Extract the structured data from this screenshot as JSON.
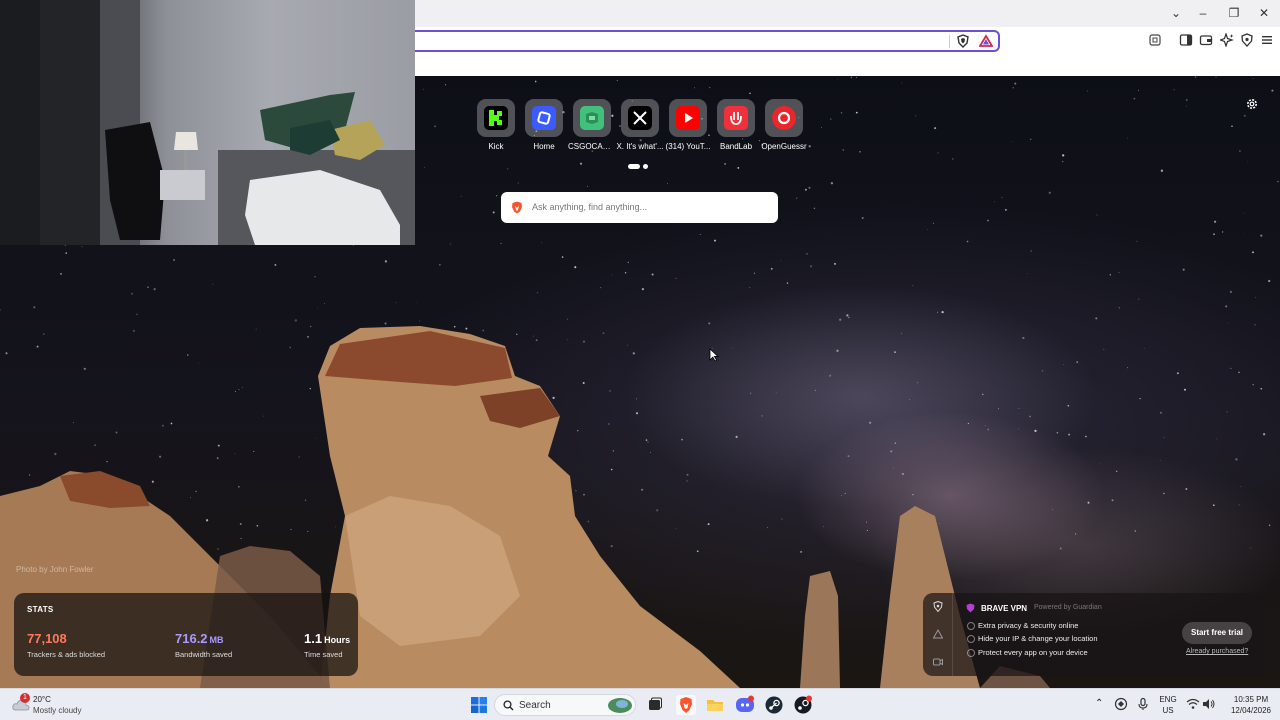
{
  "browser": {
    "search_placeholder": "Ask anything, find anything..."
  },
  "top_sites": [
    {
      "label": "Kick",
      "icon": "kick-icon",
      "color": "#53fc18"
    },
    {
      "label": "Home",
      "icon": "home-icon",
      "color": "#3b5bff"
    },
    {
      "label": "CSGOCASE...",
      "icon": "csgocase-icon",
      "color": "#41c27a"
    },
    {
      "label": "X. It's what'...",
      "icon": "x-icon",
      "color": "#000000"
    },
    {
      "label": "(314) YouT...",
      "icon": "youtube-icon",
      "color": "#ff0000"
    },
    {
      "label": "BandLab",
      "icon": "bandlab-icon",
      "color": "#f0303a"
    },
    {
      "label": "OpenGuessr",
      "icon": "openguessr-icon",
      "color": "#e8262b"
    }
  ],
  "background": {
    "photo_credit": "Photo by John Fowler"
  },
  "stats": {
    "title": "STATS",
    "trackers_value": "77,108",
    "trackers_label": "Trackers & ads blocked",
    "bandwidth_value": "716.2",
    "bandwidth_unit": "MB",
    "bandwidth_label": "Bandwidth saved",
    "time_value": "1.1",
    "time_unit": "Hours",
    "time_label": "Time saved"
  },
  "vpn": {
    "title": "BRAVE VPN",
    "powered_by": "Powered by Guardian",
    "features": [
      "Extra privacy & security online",
      "Hide your IP & change your location",
      "Protect every app on your device"
    ],
    "cta": "Start free trial",
    "already_purchased": "Already purchased?"
  },
  "taskbar": {
    "weather_temp": "20°C",
    "weather_desc": "Mostly cloudy",
    "weather_badge": "1",
    "search_label": "Search",
    "lang_line1": "ENG",
    "lang_line2": "US",
    "time": "10:35 PM",
    "date": "12/04/2026"
  },
  "colors": {
    "url_border": "#6b4fd6",
    "trackers": "#ff7a5a",
    "bandwidth": "#a79bff",
    "brave": "#fb542b"
  }
}
